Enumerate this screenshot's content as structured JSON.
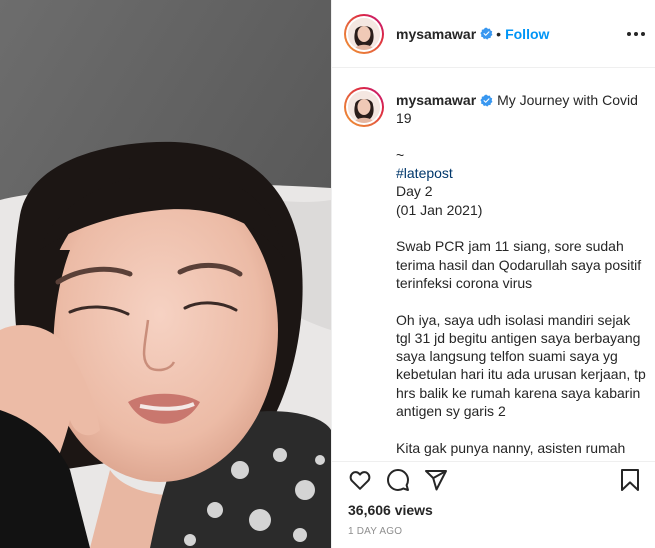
{
  "post": {
    "username": "mysamawar",
    "follow_label": "Follow",
    "separator": "•",
    "caption": {
      "title": "My Journey with Covid 19",
      "lines": [
        "~",
        "#latepost",
        "Day 2",
        "(01 Jan 2021)"
      ],
      "paragraph1": "Swab PCR jam 11 siang, sore sudah terima hasil dan Qodarullah saya positif terinfeksi corona virus",
      "paragraph2": "Oh iya, saya udh isolasi mandiri sejak tgl 31 jd begitu antigen saya berbayang saya langsung telfon suami saya yg kebetulan hari itu ada urusan kerjaan, tp hrs balik ke rumah karena saya kabarin antigen sy garis 2",
      "paragraph3": "Kita gak punya nanny, asisten rumah"
    },
    "views": "36,606 views",
    "time_ago": "1 DAY AGO"
  },
  "colors": {
    "accent": "#0095f6",
    "hashtag": "#00376b",
    "text": "#262626",
    "muted": "#8e8e8e",
    "border": "#efefef"
  },
  "icons": [
    "verified-badge-icon",
    "more-options-icon",
    "heart-icon",
    "comment-icon",
    "share-icon",
    "bookmark-icon"
  ]
}
